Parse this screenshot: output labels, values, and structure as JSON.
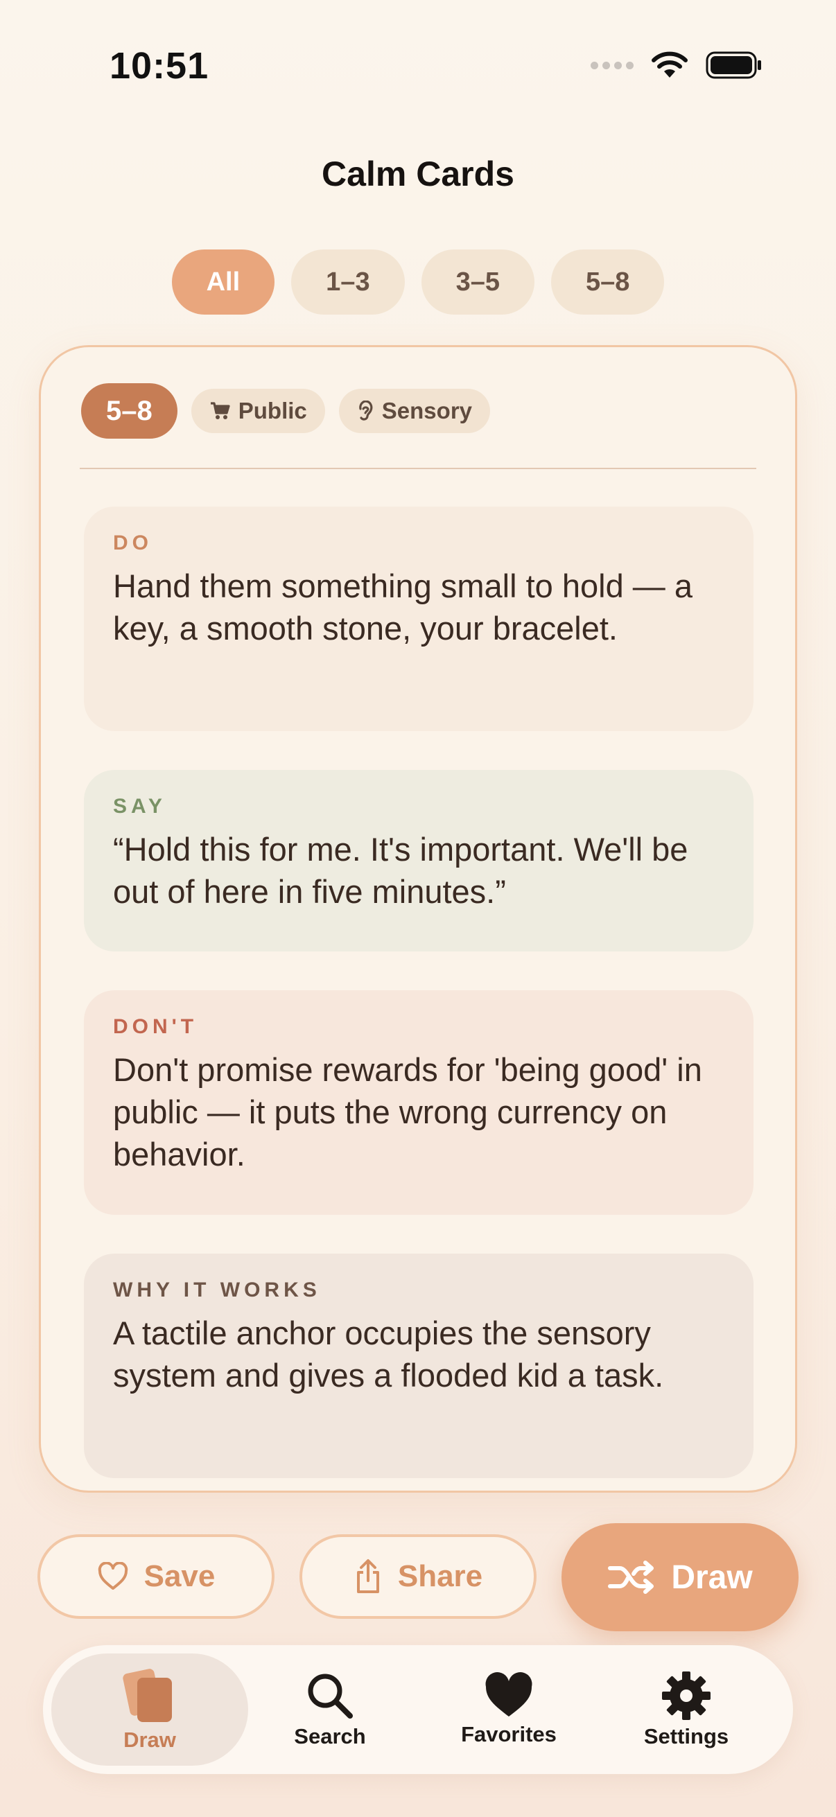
{
  "status_bar": {
    "time": "10:51"
  },
  "header": {
    "title": "Calm Cards"
  },
  "filters": [
    {
      "label": "All",
      "active": true
    },
    {
      "label": "1–3",
      "active": false
    },
    {
      "label": "3–5",
      "active": false
    },
    {
      "label": "5–8",
      "active": false
    }
  ],
  "card": {
    "age": "5–8",
    "tags": [
      {
        "icon": "cart-icon",
        "label": "Public"
      },
      {
        "icon": "ear-icon",
        "label": "Sensory"
      }
    ],
    "do": {
      "label": "DO",
      "text": "Hand them something small to hold — a key, a smooth stone, your bracelet."
    },
    "say": {
      "label": "SAY",
      "text": "“Hold this for me. It's important. We'll be out of here in five minutes.”"
    },
    "dont": {
      "label": "DON'T",
      "text": "Don't promise rewards for 'being good' in public — it puts the wrong currency on behavior."
    },
    "why": {
      "label": "WHY IT WORKS",
      "text": "A tactile anchor occupies the sensory system and gives a flooded kid a task."
    }
  },
  "actions": {
    "save_label": "Save",
    "share_label": "Share",
    "draw_label": "Draw"
  },
  "tabbar": {
    "draw": "Draw",
    "search": "Search",
    "favorites": "Favorites",
    "settings": "Settings"
  },
  "colors": {
    "accent": "#e8a67d",
    "accent_dark": "#c67d55",
    "background": "#fbf5ec"
  }
}
